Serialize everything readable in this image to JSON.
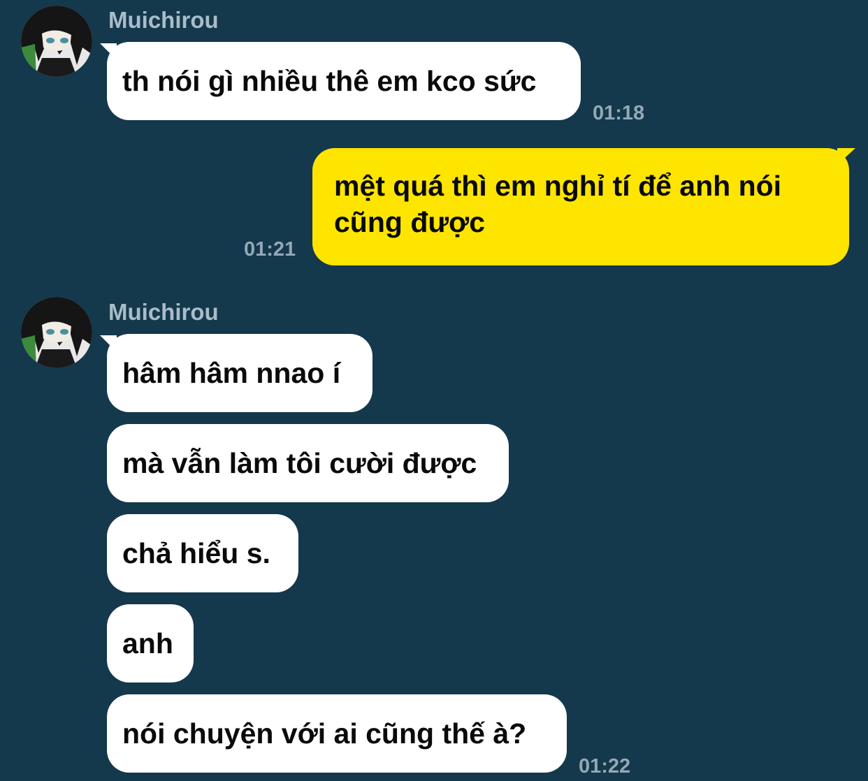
{
  "contact": {
    "name": "Muichirou",
    "avatar_icon": "anime-character-avatar-icon"
  },
  "colors": {
    "background": "#14384c",
    "incoming_bubble": "#ffffff",
    "outgoing_bubble": "#fee500",
    "timestamp": "#93a9b6",
    "sender_name": "#a9bcc8"
  },
  "messages": [
    {
      "sender": "Muichirou",
      "direction": "incoming",
      "text": "th nói gì nhiều thê em kco sức",
      "time": "01:18"
    },
    {
      "sender": "me",
      "direction": "outgoing",
      "text": "mệt quá thì em nghỉ tí để anh nói cũng được",
      "time": "01:21"
    },
    {
      "sender": "Muichirou",
      "direction": "incoming",
      "text": "hâm hâm nnao í"
    },
    {
      "sender": "Muichirou",
      "direction": "incoming",
      "text": "mà vẫn làm tôi cười được"
    },
    {
      "sender": "Muichirou",
      "direction": "incoming",
      "text": "chả hiểu s."
    },
    {
      "sender": "Muichirou",
      "direction": "incoming",
      "text": "anh"
    },
    {
      "sender": "Muichirou",
      "direction": "incoming",
      "text": "nói chuyện với ai cũng thế à?",
      "time": "01:22"
    }
  ]
}
